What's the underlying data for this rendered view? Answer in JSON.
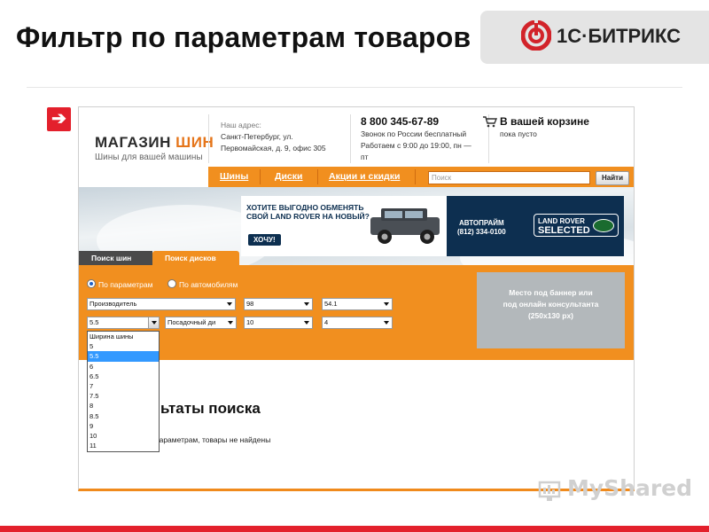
{
  "slide": {
    "title": "Фильтр по параметрам товаров",
    "logo_text": "1С·БИТРИКС",
    "watermark": "MyShared"
  },
  "store": {
    "name_part1": "МАГАЗИН",
    "name_part2": "ШИН",
    "tagline": "Шины для вашей машины",
    "address_label": "Наш адрес:",
    "address_line1": "Санкт-Петербург, ул.",
    "address_line2": "Первомайская, д. 9, офис 305",
    "phone": "8 800 345-67-89",
    "phone_note": "Звонок по России бесплатный",
    "hours_line1": "Работаем с 9:00 до 19:00, пн —",
    "hours_line2": "пт",
    "cart_title": "В вашей корзине",
    "cart_status": "пока пусто"
  },
  "nav": {
    "items": [
      "Шины",
      "Диски",
      "Акции и скидки"
    ],
    "search_placeholder": "Поиск",
    "search_button": "Найти"
  },
  "banner": {
    "headline": "ХОТИТЕ ВЫГОДНО ОБМЕНЯТЬ СВОЙ LAND ROVER НА НОВЫЙ?",
    "cta": "ХОЧУ!",
    "dealer_name": "АВТОПРАЙМ",
    "dealer_phone": "(812) 334-0100",
    "brand_line1": "LAND ROVER",
    "brand_line2": "SELECTED"
  },
  "tabs": [
    "Поиск шин",
    "Поиск дисков"
  ],
  "filter": {
    "radio_options": [
      {
        "label": "По параметрам",
        "selected": true
      },
      {
        "label": "По автомобилям",
        "selected": false
      }
    ],
    "row1": [
      "Производитель",
      "98",
      "54.1"
    ],
    "row2": [
      "5.5",
      "Посадочный ди",
      "10",
      "4"
    ],
    "ad_text_line1": "Место под баннер или",
    "ad_text_line2": "под онлайн консультанта",
    "ad_text_line3": "(250x130 px)"
  },
  "dropdown": {
    "options": [
      "Ширина шины",
      "5",
      "5.5",
      "6",
      "6.5",
      "7",
      "7.5",
      "8",
      "8.5",
      "9",
      "10",
      "11"
    ],
    "selected": "5.5"
  },
  "results": {
    "title": "ьтаты поиска",
    "message": "параметрам, товары не найдены"
  },
  "colors": {
    "accent": "#f18f1f",
    "slide_red": "#e3202c",
    "banner_navy": "#0d2f50",
    "highlight": "#3399ff"
  }
}
